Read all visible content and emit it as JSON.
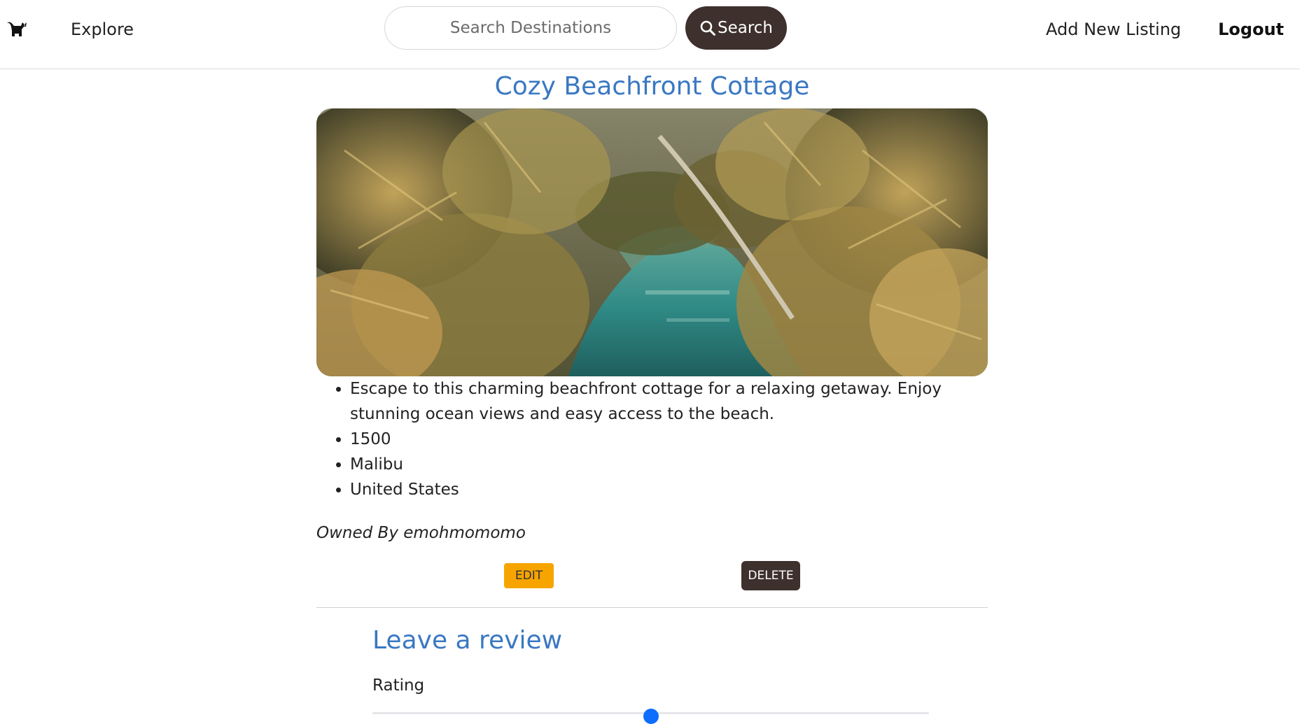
{
  "nav": {
    "brand_icon": "cat-logo-icon",
    "explore_label": "Explore",
    "search_placeholder": "Search Destinations",
    "search_button_label": "Search",
    "add_listing_label": "Add New Listing",
    "logout_label": "Logout"
  },
  "listing": {
    "title": "Cozy Beachfront Cottage",
    "image_alt": "tropical lagoon with palm trees",
    "details": [
      "Escape to this charming beachfront cottage for a relaxing getaway. Enjoy stunning ocean views and easy access to the beach.",
      "1500",
      "Malibu",
      "United States"
    ],
    "owner_text": "Owned By emohmomomo",
    "edit_label": "EDIT",
    "delete_label": "DELETE"
  },
  "review": {
    "heading": "Leave a review",
    "rating_label": "Rating",
    "rating_value_fraction": 0.5
  },
  "colors": {
    "accent_blue": "#3a78c2",
    "dark_brown": "#3e302c",
    "edit_orange": "#f7a400",
    "slider_blue": "#0d6efd"
  }
}
